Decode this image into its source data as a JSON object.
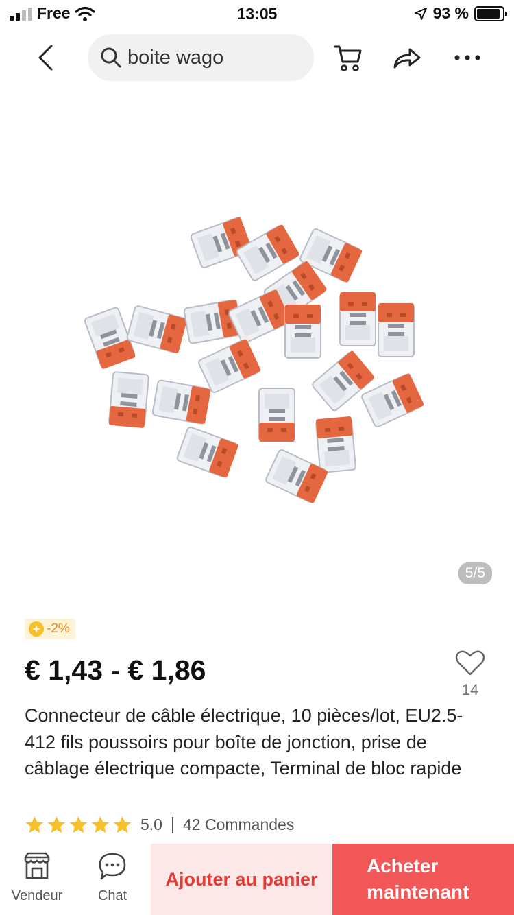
{
  "status_bar": {
    "carrier": "Free",
    "time": "13:05",
    "battery": "93 %",
    "battery_level": 0.93
  },
  "search": {
    "query": "boite wago"
  },
  "icons": {
    "back": "chevron-left-icon",
    "search": "search-icon",
    "cart": "cart-icon",
    "share": "share-icon",
    "more": "more-icon",
    "heart": "heart-icon",
    "star": "star-icon",
    "store": "store-icon",
    "chat": "chat-icon"
  },
  "gallery": {
    "counter": "5/5"
  },
  "product": {
    "discount": "-2%",
    "price": "€ 1,43 - € 1,86",
    "wishlist_count": "14",
    "title": "Connecteur de câble électrique, 10 pièces/lot, EU2.5-412 fils poussoirs pour boîte de jonction, prise de câblage électrique compacte, Terminal de bloc rapide",
    "rating": "5.0",
    "stars": 5,
    "orders": "42 Commandes"
  },
  "bottom_bar": {
    "seller_label": "Vendeur",
    "chat_label": "Chat",
    "add_to_cart": "Ajouter au panier",
    "buy_now": "Acheter maintenant"
  },
  "colors": {
    "accent": "#f25757",
    "accent_light": "#fde8e8",
    "accent_text": "#e53935",
    "star": "#f6c02b",
    "connector_orange": "#e5673f"
  }
}
